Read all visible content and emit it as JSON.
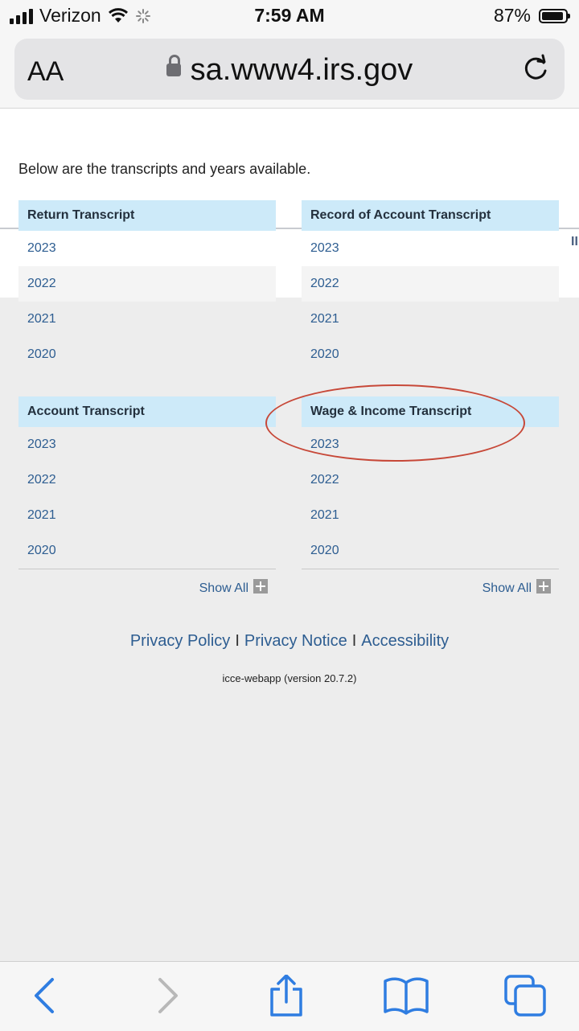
{
  "status_bar": {
    "carrier": "Verizon",
    "time": "7:59 AM",
    "battery": "87%"
  },
  "browser": {
    "text_size_label": "AA",
    "url": "sa.www4.irs.gov",
    "icons": [
      "lock-icon",
      "reload-icon",
      "back-icon",
      "forward-icon",
      "share-icon",
      "bookmarks-icon",
      "tabs-icon"
    ]
  },
  "page": {
    "intro": "Below are the transcripts and years available.",
    "edge_mark": "II",
    "panels": [
      {
        "title": "Return Transcript",
        "years": [
          "2023",
          "2022",
          "2021",
          "2020"
        ]
      },
      {
        "title": "Record of Account Transcript",
        "years": [
          "2023",
          "2022",
          "2021",
          "2020"
        ]
      },
      {
        "title": "Account Transcript",
        "years": [
          "2023",
          "2022",
          "2021",
          "2020"
        ],
        "show_all": "Show All"
      },
      {
        "title": "Wage & Income Transcript",
        "years": [
          "2023",
          "2022",
          "2021",
          "2020"
        ],
        "show_all": "Show All"
      }
    ],
    "footer": {
      "privacy_policy": "Privacy Policy",
      "privacy_notice": "Privacy Notice",
      "accessibility": "Accessibility",
      "separator": "I",
      "version": "icce-webapp (version 20.7.2)"
    },
    "annotation_color": "#c74838",
    "header_color": "#cdeaf9",
    "link_color": "#2d5d91"
  }
}
